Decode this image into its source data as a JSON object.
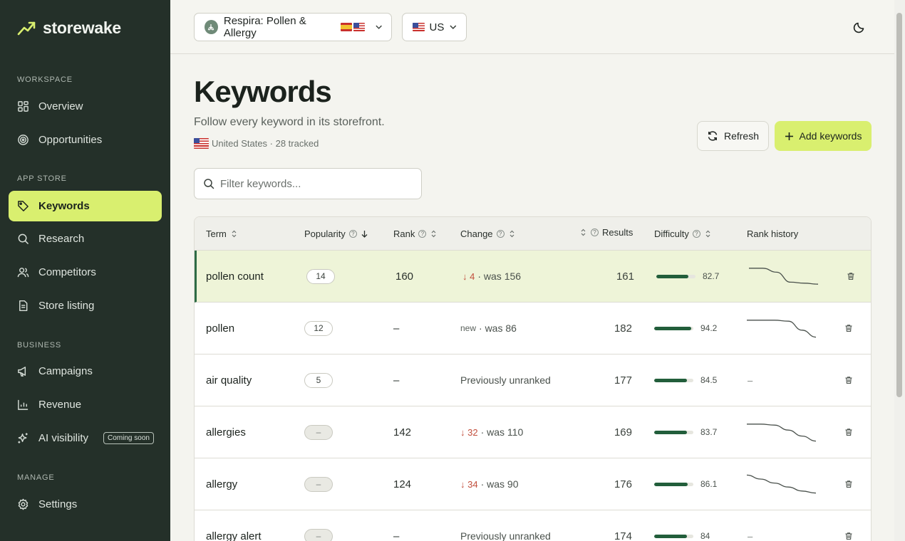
{
  "brand": {
    "name": "storewake"
  },
  "sidebar": {
    "sections": [
      {
        "label": "WORKSPACE"
      },
      {
        "label": "APP STORE"
      },
      {
        "label": "BUSINESS"
      },
      {
        "label": "MANAGE"
      }
    ],
    "items": [
      {
        "label": "Overview",
        "icon": "grid-icon"
      },
      {
        "label": "Opportunities",
        "icon": "target-icon"
      },
      {
        "label": "Keywords",
        "icon": "tag-icon",
        "active": true
      },
      {
        "label": "Research",
        "icon": "search-icon"
      },
      {
        "label": "Competitors",
        "icon": "users-icon"
      },
      {
        "label": "Store listing",
        "icon": "document-icon"
      },
      {
        "label": "Campaigns",
        "icon": "megaphone-icon"
      },
      {
        "label": "Revenue",
        "icon": "bar-chart-icon"
      },
      {
        "label": "AI visibility",
        "icon": "sparkle-icon",
        "badge": "Coming soon"
      },
      {
        "label": "Settings",
        "icon": "gear-icon"
      }
    ]
  },
  "topbar": {
    "app_name": "Respira: Pollen & Allergy",
    "country": "US"
  },
  "page": {
    "title": "Keywords",
    "subtitle": "Follow every keyword in its storefront.",
    "meta": "United States · 28 tracked",
    "refresh_label": "Refresh",
    "add_label": "Add keywords"
  },
  "filter": {
    "placeholder": "Filter keywords..."
  },
  "table": {
    "columns": [
      "Term",
      "Popularity",
      "Rank",
      "Change",
      "Results",
      "Difficulty",
      "Rank history"
    ],
    "rows": [
      {
        "term": "pollen count",
        "popularity": "14",
        "rank": "160",
        "change_delta": "4",
        "change_text": "· was 156",
        "results": "161",
        "difficulty": 82.7,
        "history": [
          0.1,
          0.1,
          0.3,
          0.8,
          0.85,
          0.9
        ]
      },
      {
        "term": "pollen",
        "popularity": "12",
        "rank": "–",
        "change_prefix": "new",
        "change_text": "· was 86",
        "results": "182",
        "difficulty": 94.2,
        "history": [
          0.1,
          0.1,
          0.1,
          0.15,
          0.6,
          0.95
        ]
      },
      {
        "term": "air quality",
        "popularity": "5",
        "rank": "–",
        "change_text": "Previously unranked",
        "results": "177",
        "difficulty": 84.5,
        "history": null
      },
      {
        "term": "allergies",
        "popularity": "–",
        "rank": "142",
        "change_delta": "32",
        "change_text": "· was 110",
        "results": "169",
        "difficulty": 83.7,
        "history": [
          0.1,
          0.1,
          0.15,
          0.4,
          0.7,
          0.95
        ]
      },
      {
        "term": "allergy",
        "popularity": "–",
        "rank": "124",
        "change_delta": "34",
        "change_text": "· was 90",
        "results": "176",
        "difficulty": 86.1,
        "history": [
          0.05,
          0.25,
          0.45,
          0.65,
          0.85,
          0.95
        ]
      },
      {
        "term": "allergy alert",
        "popularity": "–",
        "rank": "–",
        "change_text": "Previously unranked",
        "results": "174",
        "difficulty": 84,
        "history": null
      }
    ]
  }
}
